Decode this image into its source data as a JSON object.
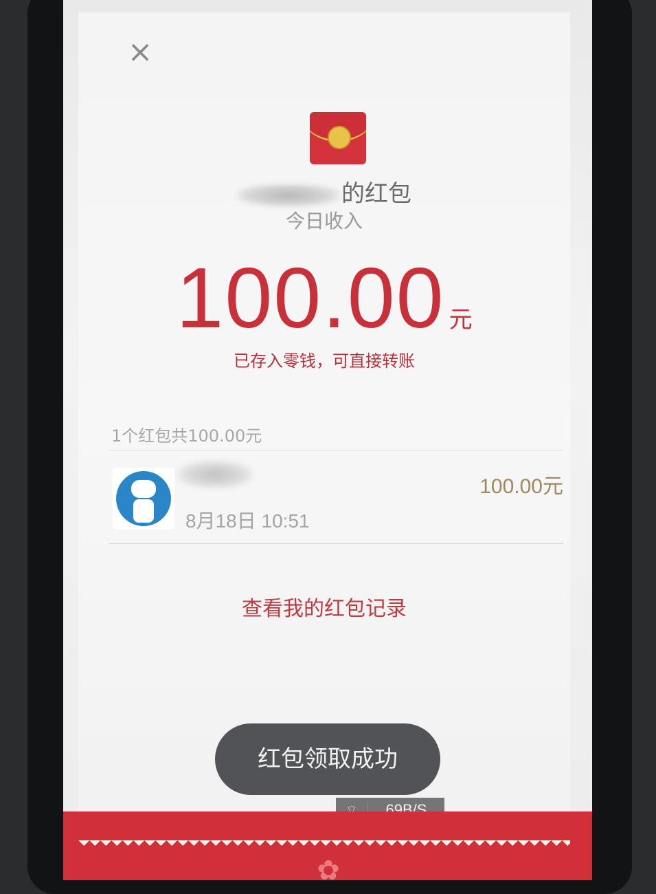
{
  "header": {
    "close_icon": "close-icon",
    "envelope_icon": "red-envelope-icon",
    "sender_title_suffix": "的红包",
    "subtitle": "今日收入"
  },
  "amount": {
    "value": "100.00",
    "unit": "元",
    "note": "已存入零钱，可直接转账"
  },
  "summary": {
    "text": "1个红包共100.00元"
  },
  "records": [
    {
      "avatar_icon": "robot-avatar-icon",
      "time": "8月18日  10:51",
      "amount": "100.00元"
    }
  ],
  "history_link": "查看我的红包记录",
  "toast": "红包领取成功",
  "status": {
    "wifi_icon": "wifi-icon",
    "speed": "69B/S"
  },
  "colors": {
    "accent_red": "#c8303a",
    "gold": "#9e8a5c",
    "footer_red": "#d23038"
  }
}
